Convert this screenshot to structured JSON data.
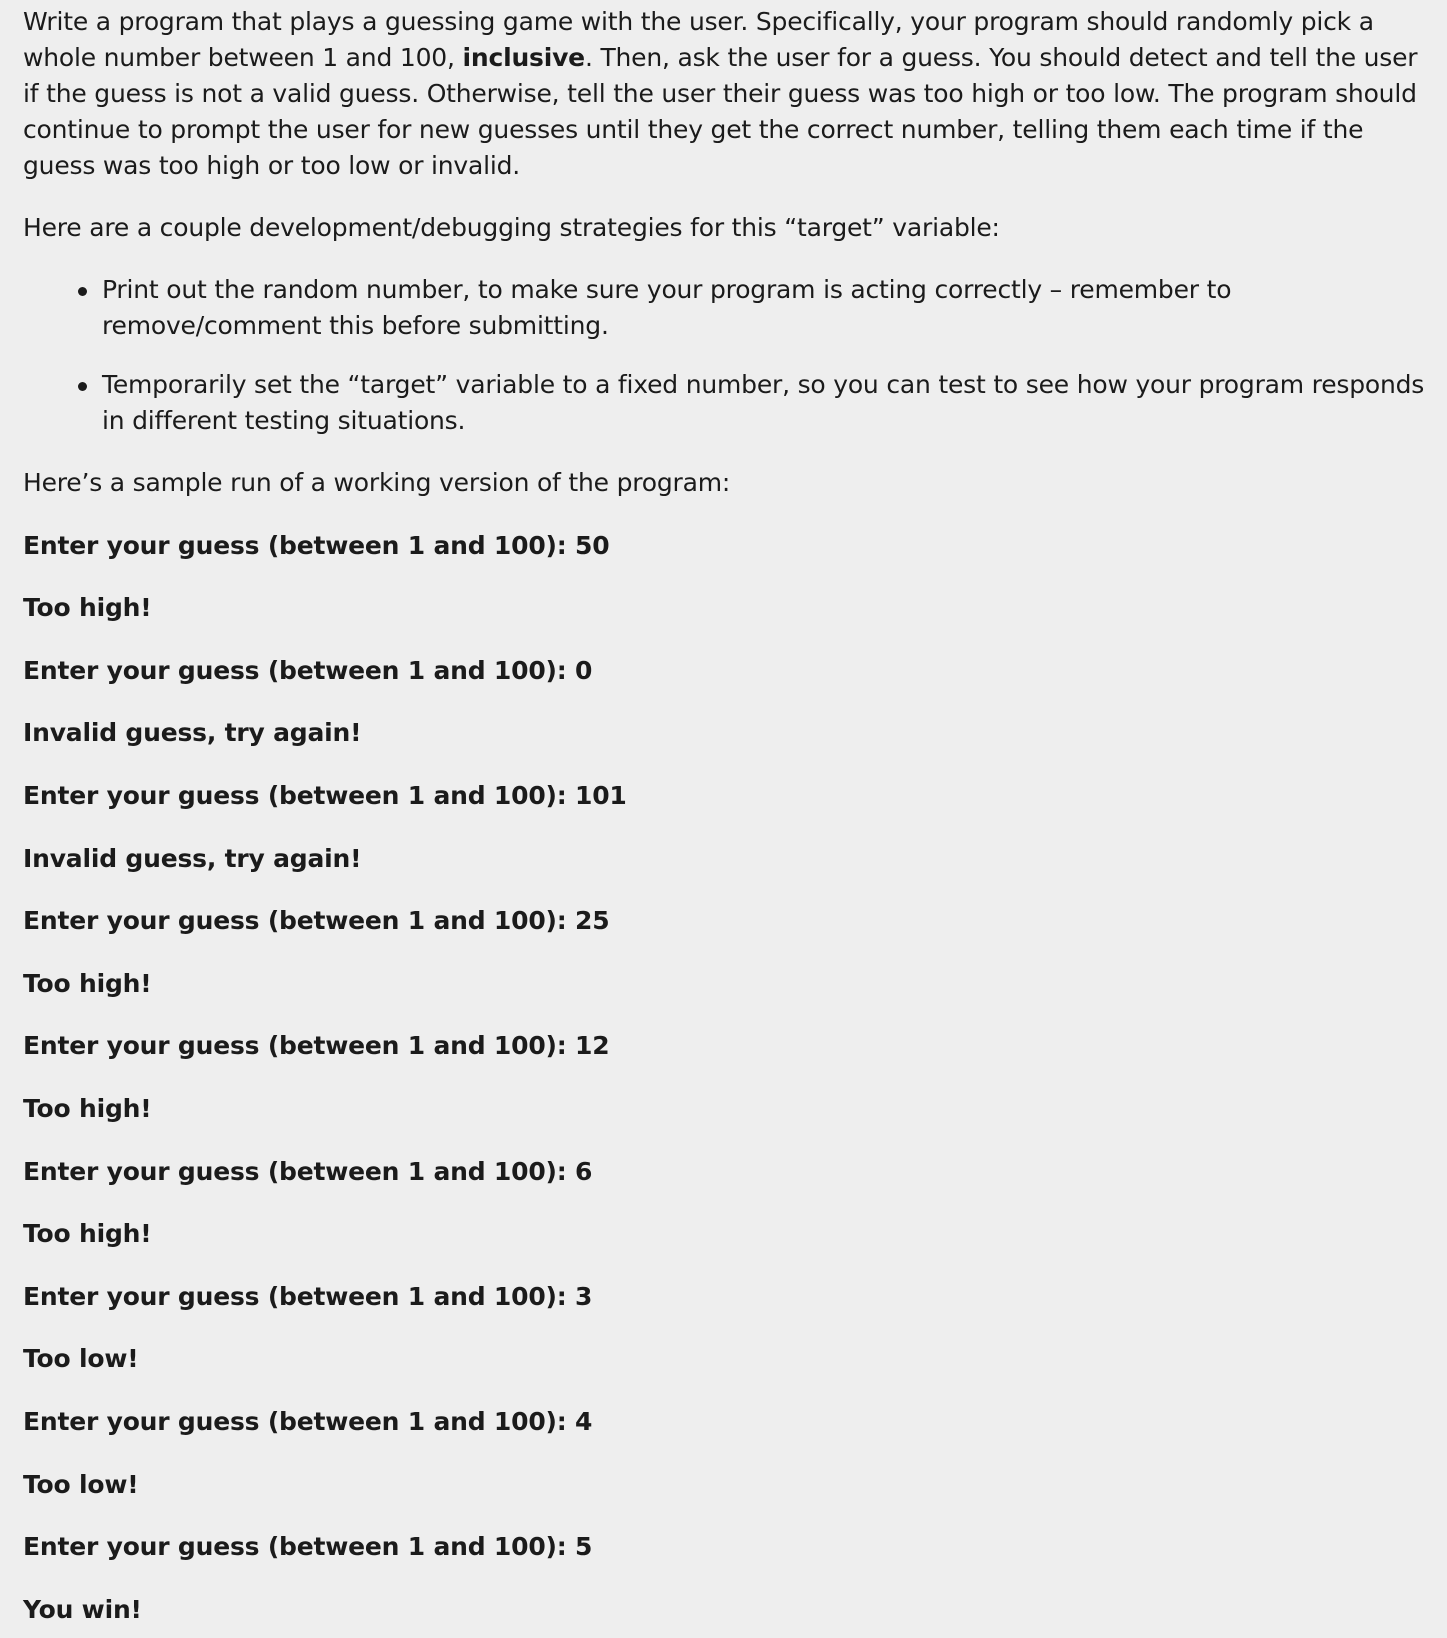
{
  "intro": {
    "part1": "Write a program that plays a guessing game with the user. Specifically, your program should randomly pick a whole number between 1 and 100, ",
    "bold": "inclusive",
    "part2": ". Then, ask the user for a guess. You should detect and tell the user if the guess is not a valid guess. Otherwise, tell the user their guess was too high or too low. The program should continue to prompt the user for new guesses until they get the correct number, telling them each time if the guess was too high or too low or invalid."
  },
  "strategies_intro": "Here are a couple development/debugging strategies for this “target” variable:",
  "strategies": [
    "Print out the random number, to make sure your program is acting correctly – remember to remove/comment this before submitting.",
    "Temporarily set the “target” variable to a fixed number, so you can test to see how your program responds in different testing situations."
  ],
  "sample_intro": "Here’s a sample run of a working version of the program:",
  "sample_run": [
    "Enter your guess (between 1 and 100): 50",
    "Too high!",
    "Enter your guess (between 1 and 100): 0",
    "Invalid guess, try again!",
    "Enter your guess (between 1 and 100): 101",
    "Invalid guess, try again!",
    "Enter your guess (between 1 and 100): 25",
    "Too high!",
    "Enter your guess (between 1 and 100): 12",
    "Too high!",
    "Enter your guess (between 1 and 100): 6",
    "Too high!",
    "Enter your guess (between 1 and 100): 3",
    "Too low!",
    "Enter your guess (between 1 and 100): 4",
    "Too low!",
    "Enter your guess (between 1 and 100): 5",
    "You win!"
  ]
}
